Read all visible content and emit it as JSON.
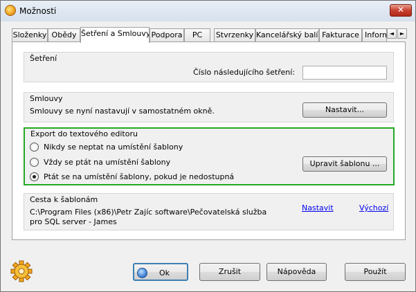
{
  "window": {
    "title": "Možnosti",
    "close_label": "✕"
  },
  "tabs": [
    {
      "label": "Složenky"
    },
    {
      "label": "Obědy"
    },
    {
      "label": "Šetření a Smlouvy"
    },
    {
      "label": "Podpora"
    },
    {
      "label": "PC"
    },
    {
      "label": "Stvrzenky"
    },
    {
      "label": "Kancelářský balík"
    },
    {
      "label": "Fakturace"
    },
    {
      "label": "Inform"
    }
  ],
  "tab_scroll": {
    "left": "◄",
    "right": "►"
  },
  "setreni": {
    "title": "Šetření",
    "next_number_label": "Číslo následujícího šetření:",
    "next_number_value": ""
  },
  "smlouvy": {
    "title": "Smlouvy",
    "text": "Smlouvy se nyní nastavují v samostatném okně.",
    "button": "Nastavit..."
  },
  "export": {
    "title": "Export do textového editoru",
    "options": [
      {
        "label": "Nikdy se neptat na umístění šablony",
        "checked": false
      },
      {
        "label": "Vždy se ptát na umístění šablony",
        "checked": false
      },
      {
        "label": "Ptát se na umístění šablony, pokud je nedostupná",
        "checked": true
      }
    ],
    "button": "Upravit šablonu ...",
    "highlight_color": "#22aa22"
  },
  "cesta": {
    "title": "Cesta k šablonám",
    "path_line1": "C:\\Program Files (x86)\\Petr Zajíc software\\Pečovatelská služba",
    "path_line2": "pro SQL server - James",
    "link_set": "Nastavit",
    "link_default": "Výchozí"
  },
  "footer": {
    "ok": "Ok",
    "cancel": "Zrušit",
    "help": "Nápověda",
    "apply": "Použít"
  }
}
